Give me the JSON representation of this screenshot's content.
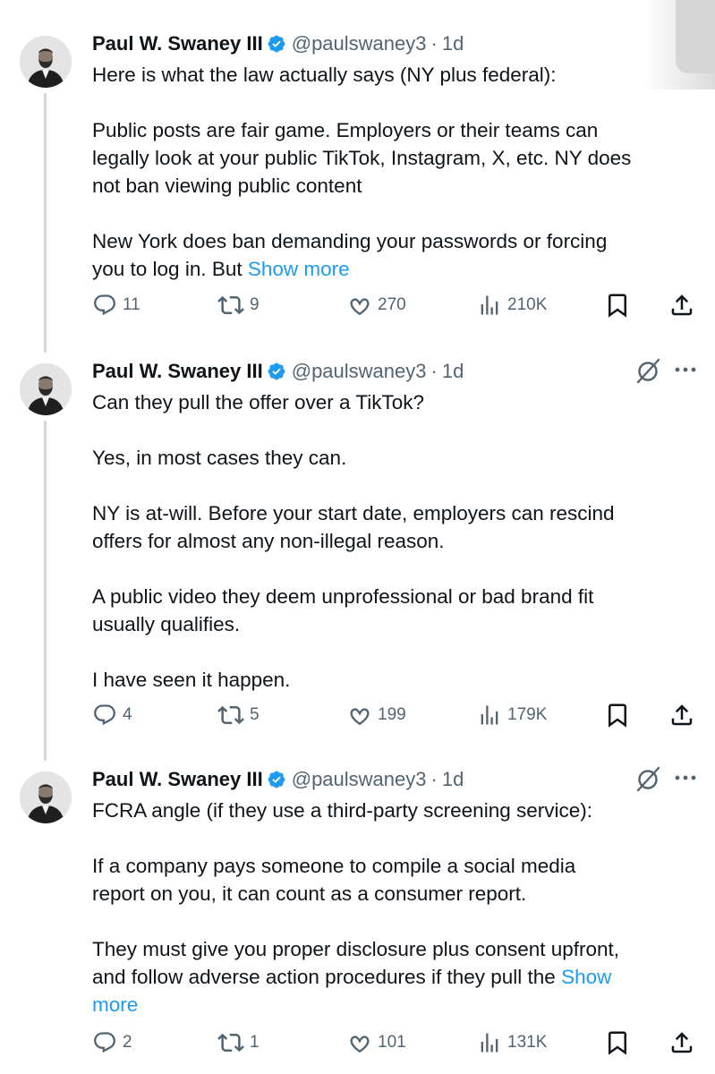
{
  "tweets": [
    {
      "author": "Paul W. Swaney III",
      "handle": "@paulswaney3",
      "time": "1d",
      "paragraphs": [
        [
          "Here is what the law actually says (NY plus federal):"
        ],
        [
          "Public posts are fair game. Employers or their teams can",
          "legally look at your public TikTok, Instagram, X, etc. NY does",
          "not ban viewing public content"
        ],
        [
          "New York does ban demanding your passwords or forcing",
          "you to log in. But "
        ]
      ],
      "show_more": "Show more",
      "stats": {
        "replies": "11",
        "reposts": "9",
        "likes": "270",
        "views": "210K"
      }
    },
    {
      "author": "Paul W. Swaney III",
      "handle": "@paulswaney3",
      "time": "1d",
      "paragraphs": [
        [
          "Can they pull the offer over a TikTok?"
        ],
        [
          "Yes, in most cases they can."
        ],
        [
          "NY is at-will. Before your start date, employers can rescind",
          "offers for almost any non-illegal reason."
        ],
        [
          "A public video they deem unprofessional or bad brand fit",
          "usually qualifies."
        ],
        [
          "I have seen it happen."
        ]
      ],
      "stats": {
        "replies": "4",
        "reposts": "5",
        "likes": "199",
        "views": "179K"
      }
    },
    {
      "author": "Paul W. Swaney III",
      "handle": "@paulswaney3",
      "time": "1d",
      "paragraphs": [
        [
          "FCRA angle (if they use a third-party screening service):"
        ],
        [
          "If a company pays someone to compile a social media",
          "report on you, it can count as a consumer report."
        ],
        [
          "They must give you proper disclosure plus consent upfront,",
          "and follow adverse action procedures if they pull the "
        ]
      ],
      "show_more_a": "Show",
      "show_more_b": "more",
      "stats": {
        "replies": "2",
        "reposts": "1",
        "likes": "101",
        "views": "131K"
      }
    }
  ],
  "separator": "·",
  "colors": {
    "accent": "#1d9bf0",
    "muted": "#536471",
    "text": "#0f1419",
    "verified": "#1d9bf0"
  },
  "icons": [
    "verified-badge-icon",
    "grok-icon",
    "more-options-icon",
    "reply-icon",
    "repost-icon",
    "like-icon",
    "views-icon",
    "bookmark-icon",
    "share-icon"
  ]
}
